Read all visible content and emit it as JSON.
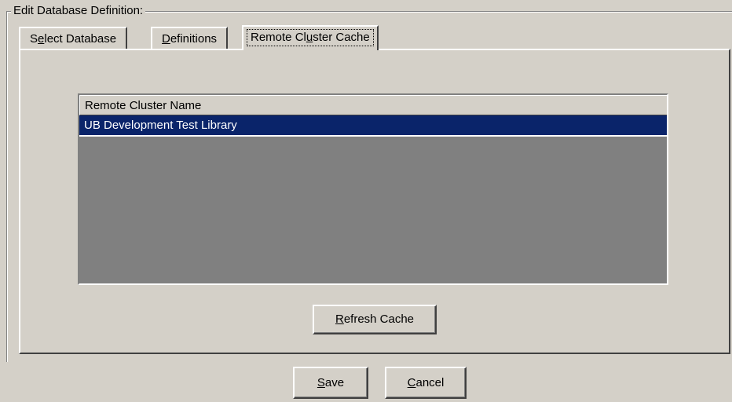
{
  "group": {
    "legend": "Edit  Database Definition:"
  },
  "tabs": [
    {
      "pre": "S",
      "accel": "e",
      "post": "lect Database",
      "active": false
    },
    {
      "pre": "",
      "accel": "D",
      "post": "efinitions",
      "active": false
    },
    {
      "pre": "Remote Cl",
      "accel": "u",
      "post": "ster Cache",
      "active": true
    }
  ],
  "list": {
    "column_header": "Remote Cluster Name",
    "rows": [
      {
        "name": "UB Development Test Library",
        "selected": true
      }
    ]
  },
  "buttons": {
    "refresh": {
      "accel": "R",
      "rest": "efresh Cache"
    },
    "save": {
      "accel": "S",
      "rest": "ave"
    },
    "cancel": {
      "accel": "C",
      "rest": "ancel"
    }
  },
  "colors": {
    "face": "#d4d0c8",
    "selection": "#0a246a",
    "list_background": "#808080"
  }
}
